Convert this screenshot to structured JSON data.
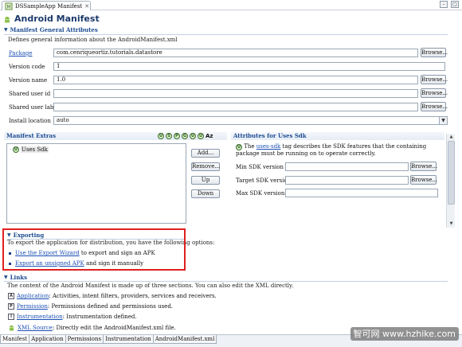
{
  "editor_tab": {
    "title": "DSSampleApp Manifest"
  },
  "page": {
    "title": "Android Manifest"
  },
  "general": {
    "header": "Manifest General Attributes",
    "description": "Defines general information about the AndroidManifest.xml",
    "fields": [
      {
        "label": "Package",
        "value": "com.cenriqueortiz.tutorials.datastore",
        "has_browse": true,
        "is_link": true
      },
      {
        "label": "Version code",
        "value": "1",
        "has_browse": false,
        "is_link": false
      },
      {
        "label": "Version name",
        "value": "1.0",
        "has_browse": true,
        "is_link": false
      },
      {
        "label": "Shared user id",
        "value": "",
        "has_browse": true,
        "is_link": false
      },
      {
        "label": "Shared user label",
        "value": "",
        "has_browse": true,
        "is_link": false
      },
      {
        "label": "Install location",
        "value": "auto",
        "has_browse": false,
        "is_link": false
      }
    ],
    "browse_label": "Browse..."
  },
  "extras": {
    "header": "Manifest Extras",
    "toolbar_icons": [
      "U",
      "S",
      "P",
      "G",
      "U",
      "U"
    ],
    "sort_label": "Az",
    "tree_item": "Uses Sdk",
    "buttons": [
      "Add...",
      "Remove...",
      "Up",
      "Down"
    ]
  },
  "attributes": {
    "header": "Attributes for Uses Sdk",
    "desc_prefix": "The ",
    "desc_link": "uses-sdk",
    "desc_rest": " tag describes the SDK features that the containing package must be running on to operate correctly.",
    "fields": [
      {
        "label": "Min SDK version",
        "value": "",
        "has_browse": true
      },
      {
        "label": "Target SDK version",
        "value": "",
        "has_browse": true
      },
      {
        "label": "Max SDK version",
        "value": "",
        "has_browse": false
      }
    ],
    "browse_label": "Browse..."
  },
  "exporting": {
    "header": "Exporting",
    "description": "To export the application for distribution, you have the following options:",
    "items": [
      {
        "link": "Use the Export Wizard",
        "rest": " to export and sign an APK"
      },
      {
        "link": "Export an unsigned APK",
        "rest": " and sign it manually"
      }
    ]
  },
  "links": {
    "header": "Links",
    "description": "The content of the Android Manifest is made up of three sections. You can also edit the XML directly.",
    "items": [
      {
        "icon": "A",
        "link": "Application",
        "rest": ": Activities, intent filters, providers, services and receivers."
      },
      {
        "icon": "P",
        "link": "Permission",
        "rest": ": Permissions defined and permissions used."
      },
      {
        "icon": "I",
        "link": "Instrumentation",
        "rest": ": Instrumentation defined."
      },
      {
        "icon": "droid",
        "link": "XML Source",
        "rest": ": Directly edit the AndroidManifest.xml file."
      }
    ]
  },
  "bottom_tabs": [
    "Manifest",
    "Application",
    "Permissions",
    "Instrumentation",
    "AndroidManifest.xml"
  ],
  "watermark": "智可网 www.hzhike.com",
  "colors": {
    "section_blue": "#1c4b91",
    "link_blue": "#1a4fb4",
    "highlight_red": "#e02020"
  }
}
